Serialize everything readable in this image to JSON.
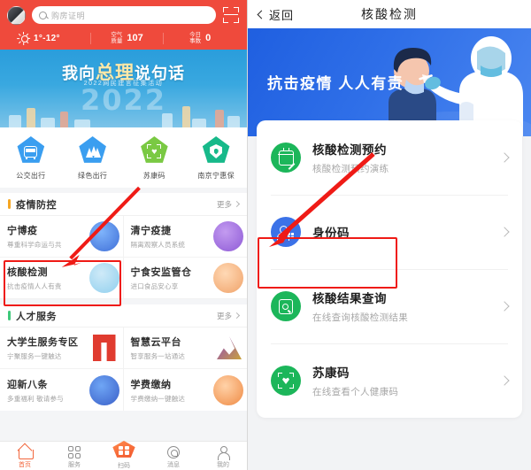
{
  "left": {
    "topbar": {
      "avatar_name": "user-avatar",
      "search_placeholder": "购房证明",
      "search_icon": "search-icon",
      "scan_icon": "scan-code-icon"
    },
    "weather": {
      "sun_icon": "sun-icon",
      "temperature": "1°-12°",
      "aqi_label_1": "空气",
      "aqi_label_2": "质量",
      "aqi_value": "107",
      "todo_label_1": "今日",
      "todo_label_2": "事数",
      "todo_value": "0"
    },
    "hero": {
      "title_a": "我向",
      "title_b": "总理",
      "title_c": "说句话",
      "subtitle": "2022网民建言征集活动",
      "year": "2022"
    },
    "quick_icons": [
      {
        "label": "公交出行",
        "icon": "bus-icon",
        "color": "#3a9ef0"
      },
      {
        "label": "绿色出行",
        "icon": "tree-icon",
        "color": "#3a9ef0"
      },
      {
        "label": "苏康码",
        "icon": "health-qr-icon",
        "color": "#7ac943"
      },
      {
        "label": "南京宁惠保",
        "icon": "shield-icon",
        "color": "#17b98a"
      }
    ],
    "sections": [
      {
        "title": "疫情防控",
        "bar_color": "#f5a623",
        "more": "更多",
        "items": [
          {
            "title": "宁博疫",
            "sub": "尊重科学命运与共",
            "art_color": "#5b8ff9"
          },
          {
            "title": "清宁疫捷",
            "sub": "隔离观察人员系统",
            "art_color": "#9b6ae0"
          },
          {
            "title": "核酸检测",
            "sub": "抗击疫情人人有责",
            "art_color": "#9fd7ef"
          },
          {
            "title": "宁食安监管仓",
            "sub": "进口食品安心享",
            "art_color": "#f2a365"
          }
        ]
      },
      {
        "title": "人才服务",
        "bar_color": "#3ec97a",
        "more": "更多",
        "items": [
          {
            "title": "大学生服务专区",
            "sub": "宁聚服务一键触达",
            "art_color": "#e03b2f"
          },
          {
            "title": "智慧云平台",
            "sub": "智享服务一站通达",
            "art_color": "#8e44c7"
          },
          {
            "title": "迎新八条",
            "sub": "多重福利 敬请参与",
            "art_color": "#4a7fe0"
          },
          {
            "title": "学费缴纳",
            "sub": "学费缴纳一键触达",
            "art_color": "#f0803c"
          }
        ]
      }
    ],
    "tabbar": [
      {
        "label": "首页",
        "icon": "home-icon",
        "active": true
      },
      {
        "label": "服务",
        "icon": "grid-icon",
        "active": false
      },
      {
        "label": "扫码",
        "icon": "scan-qr-icon",
        "active": false
      },
      {
        "label": "消息",
        "icon": "chat-icon",
        "active": false
      },
      {
        "label": "我的",
        "icon": "profile-icon",
        "active": false
      }
    ],
    "annotation": {
      "highlight_color": "#ef1b16",
      "highlighted_item": "核酸检测"
    }
  },
  "right": {
    "header": {
      "back_label": "返回",
      "back_icon": "chevron-left-icon",
      "title": "核酸检测"
    },
    "banner": {
      "title": "抗击疫情 人人有责",
      "bg_color": "#2f6fe8",
      "illustration": "nucleic-acid-test-illustration"
    },
    "list": [
      {
        "title": "核酸检测预约",
        "sub": "核酸检测预约演练",
        "icon": "calendar-edit-icon",
        "icon_color": "#1cb65a",
        "chevron": "chevron-right-icon",
        "highlighted": false
      },
      {
        "title": "身份码",
        "sub": "",
        "icon": "person-qr-icon",
        "icon_color": "#3b72e8",
        "chevron": "chevron-right-icon",
        "highlighted": true
      },
      {
        "title": "核酸结果查询",
        "sub": "在线查询核酸检测结果",
        "icon": "document-search-icon",
        "icon_color": "#1cb65a",
        "chevron": "chevron-right-icon",
        "highlighted": false
      },
      {
        "title": "苏康码",
        "sub": "在线查看个人健康码",
        "icon": "health-qr-icon",
        "icon_color": "#1cb65a",
        "chevron": "chevron-right-icon",
        "highlighted": false
      }
    ],
    "annotation": {
      "highlight_color": "#ef1b16",
      "highlighted_item": "身份码"
    }
  }
}
